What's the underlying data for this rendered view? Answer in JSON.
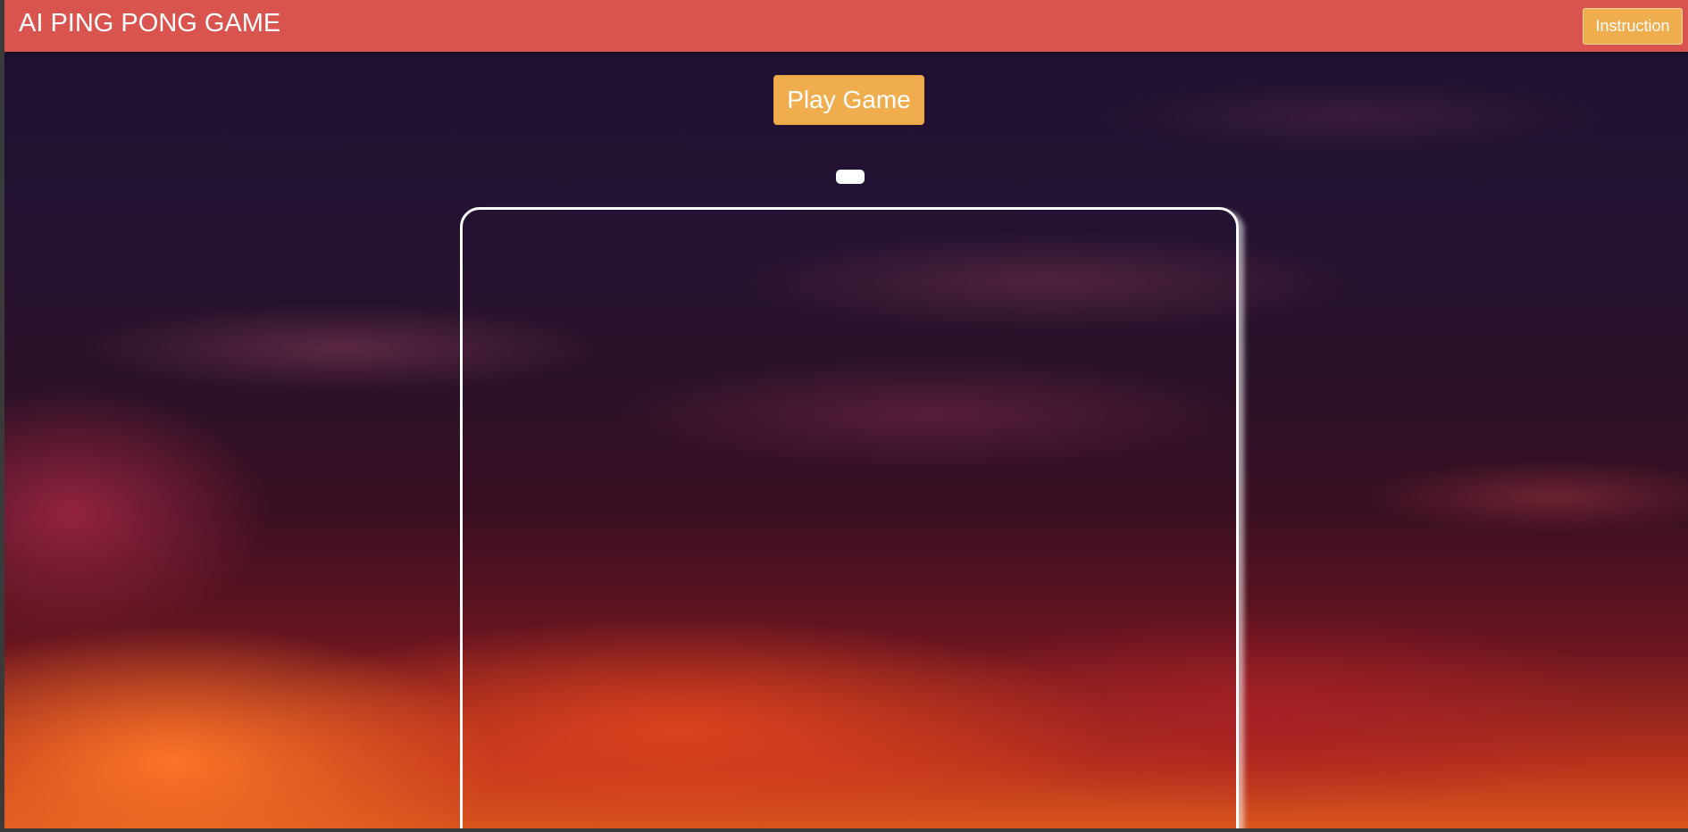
{
  "header": {
    "title": "AI PING PONG GAME",
    "instruction_label": "Instruction",
    "bar_color": "#d9534f"
  },
  "main": {
    "play_label": "Play Game",
    "button_color": "#f0ad4e"
  },
  "game": {
    "ai_paddle": "ai-paddle",
    "board_border_color": "#ffffff"
  }
}
